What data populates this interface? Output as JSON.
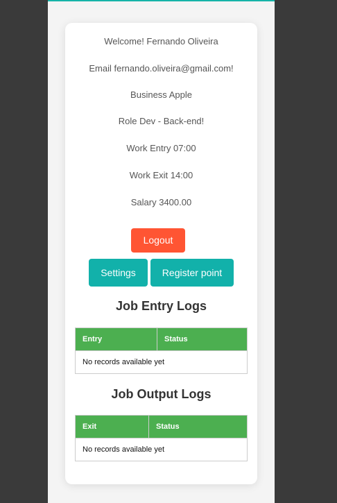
{
  "profile": {
    "welcome": "Welcome! Fernando Oliveira",
    "email": "Email fernando.oliveira@gmail.com!",
    "business": "Business Apple",
    "role": "Role Dev - Back-end!",
    "work_entry": "Work Entry 07:00",
    "work_exit": "Work Exit 14:00",
    "salary": "Salary 3400.00"
  },
  "actions": {
    "logout": "Logout",
    "settings": "Settings",
    "register_point": "Register point"
  },
  "entry_logs": {
    "title": "Job Entry Logs",
    "columns": [
      "Entry",
      "Status"
    ],
    "empty": "No records available yet"
  },
  "output_logs": {
    "title": "Job Output Logs",
    "columns": [
      "Exit",
      "Status"
    ],
    "empty": "No records available yet"
  },
  "colors": {
    "accent": "#12b1aa",
    "logout": "#ff5533",
    "table_header": "#4caf50"
  }
}
